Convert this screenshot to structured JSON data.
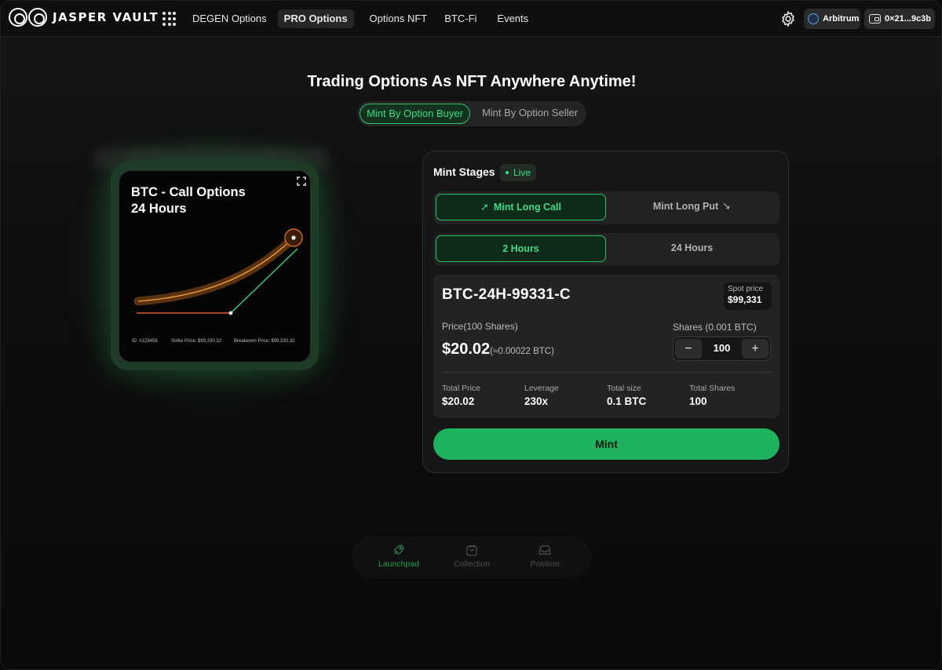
{
  "app": {
    "brand": "JASPER VAULT",
    "nav": [
      {
        "label": "DEGEN Options",
        "active": false
      },
      {
        "label": "PRO Options",
        "active": true
      },
      {
        "label": "Options NFT",
        "active": false
      },
      {
        "label": "BTC-Fi",
        "active": false
      },
      {
        "label": "Events",
        "active": false
      }
    ],
    "network": "Arbitrum",
    "wallet": "0×21...9c3b"
  },
  "hero": {
    "headline": "Trading Options As NFT Anywhere Anytime!",
    "modes": [
      "Mint By Option Buyer",
      "Mint By Option Seller"
    ],
    "active_mode": "Mint By Option Buyer"
  },
  "nft_card": {
    "title_line1": "BTC - Call Options",
    "title_line2": "24 Hours",
    "id": "ID: #123456",
    "strike": "Strike Price: $99,330.32",
    "breakeven": "Breakeven Price: $99,330.32"
  },
  "mint": {
    "stages_label": "Mint Stages",
    "status": "Live",
    "direction": {
      "on": "Mint Long Call",
      "off": "Mint Long Put"
    },
    "duration": {
      "on": "2 Hours",
      "off": "24 Hours"
    },
    "symbol": "BTC-24H-99331-C",
    "spot_label": "Spot price",
    "spot_value": "$99,331",
    "price_label": "Price(100 Shares)",
    "price_value": "$20.02",
    "price_btc": "(≈0.00022 BTC)",
    "shares_label": "Shares (0.001 BTC)",
    "shares_value": "100",
    "stats": [
      {
        "label": "Total Price",
        "value": "$20.02"
      },
      {
        "label": "Leverage",
        "value": "230x"
      },
      {
        "label": "Total size",
        "value": "0.1 BTC"
      },
      {
        "label": "Total Shares",
        "value": "100"
      }
    ],
    "cta": "Mint"
  },
  "dock": [
    {
      "label": "Launchpad",
      "icon": "rocket-icon",
      "active": true
    },
    {
      "label": "Collection",
      "icon": "bag-icon",
      "active": false
    },
    {
      "label": "Position",
      "icon": "inbox-icon",
      "active": false
    }
  ],
  "colors": {
    "accent": "#3ddc84",
    "cta": "#1fb35f",
    "curve": "#f0a23a",
    "strike_line": "#e8542c"
  }
}
